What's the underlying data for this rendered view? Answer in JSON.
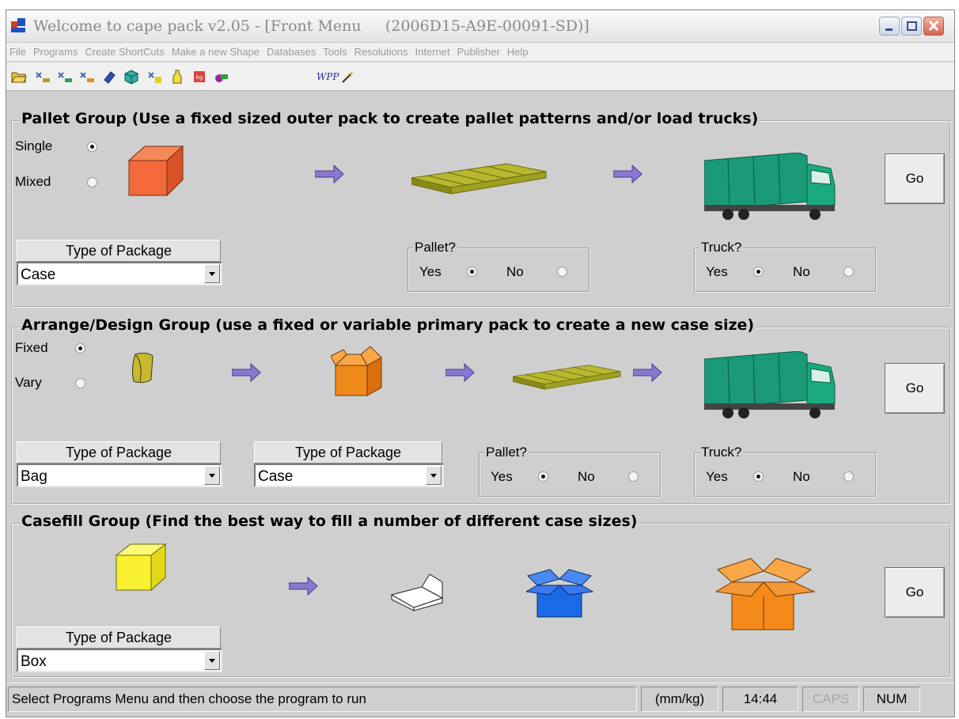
{
  "window": {
    "title": "Welcome to cape pack v2.05 - [Front Menu     (2006D15-A9E-00091-SD)]"
  },
  "menu": [
    "File",
    "Programs",
    "Create ShortCuts",
    "Make a new Shape",
    "Databases",
    "Tools",
    "Resolutions",
    "Internet",
    "Publisher",
    "Help"
  ],
  "toolbar": {
    "icons": [
      "open-folder-icon",
      "pallet-arrange-icon",
      "arrange-icon",
      "casefill-icon",
      "tool-icon",
      "box-3d-icon",
      "design-icon",
      "bottle-icon",
      "weight-icon",
      "tube-icon"
    ],
    "wpp_label": "WPP",
    "wand_icon": "magic-wand-icon"
  },
  "pallet_group": {
    "title": "Pallet Group (Use a fixed sized outer pack to create pallet patterns and/or load trucks)",
    "single_label": "Single",
    "mixed_label": "Mixed",
    "selected": "Single",
    "go_label": "Go",
    "package_label": "Type of Package",
    "package_value": "Case",
    "pallet_frame_title": "Pallet?",
    "pallet_yes": "Yes",
    "pallet_no": "No",
    "pallet_selected": "Yes",
    "truck_frame_title": "Truck?",
    "truck_yes": "Yes",
    "truck_no": "No",
    "truck_selected": "Yes",
    "colors": {
      "case": "#f26a3a",
      "pallet": "#9a9a1a",
      "truck": "#1a9a78",
      "arrow": "#8a78d0"
    }
  },
  "arrange_group": {
    "title": "Arrange/Design Group (use a fixed or variable primary pack to create a new case size)",
    "fixed_label": "Fixed",
    "vary_label": "Vary",
    "selected": "Fixed",
    "go_label": "Go",
    "package1_label": "Type of Package",
    "package1_value": "Bag",
    "package2_label": "Type of Package",
    "package2_value": "Case",
    "pallet_frame_title": "Pallet?",
    "pallet_yes": "Yes",
    "pallet_no": "No",
    "pallet_selected": "Yes",
    "truck_frame_title": "Truck?",
    "truck_yes": "Yes",
    "truck_no": "No",
    "truck_selected": "Yes",
    "colors": {
      "bag": "#c9b830",
      "case": "#f08a1a"
    }
  },
  "casefill_group": {
    "title": "Casefill Group (Find the best way to fill a number of different case sizes)",
    "go_label": "Go",
    "package_label": "Type of Package",
    "package_value": "Box",
    "colors": {
      "box": "#f8f030",
      "tray": "#ffffff",
      "blue_case": "#1a6ae8",
      "orange_case": "#f58a1a"
    }
  },
  "status": {
    "message": "Select Programs Menu and then choose the program to run",
    "units": "(mm/kg)",
    "time": "14:44",
    "caps": "CAPS",
    "num": "NUM"
  }
}
